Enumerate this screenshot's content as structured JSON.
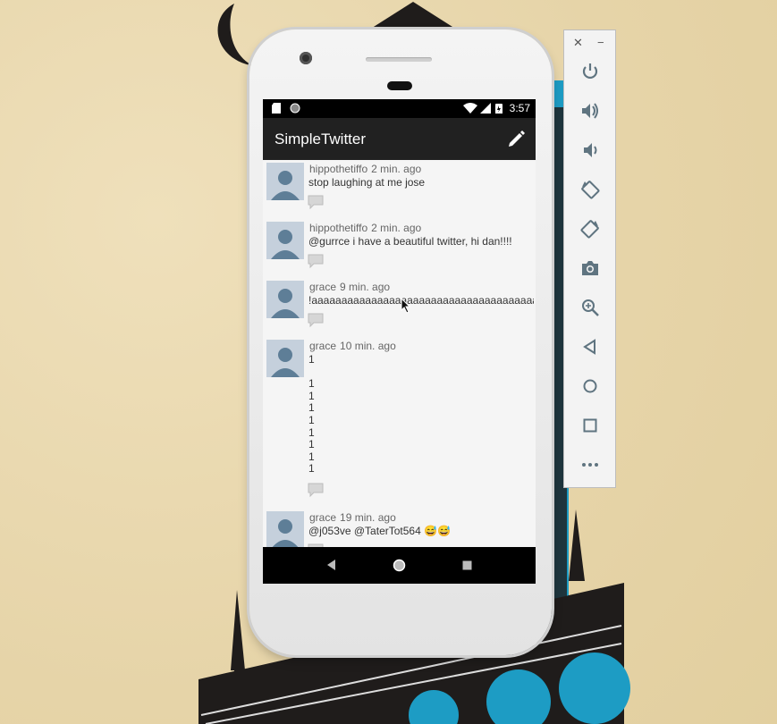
{
  "status_bar": {
    "time": "3:57"
  },
  "app": {
    "title": "SimpleTwitter",
    "compose_icon": "pencil-icon"
  },
  "tweets": [
    {
      "user": "hippothetiffo",
      "time": "2 min. ago",
      "text": "stop laughing at me jose"
    },
    {
      "user": "hippothetiffo",
      "time": "2 min. ago",
      "text": "@gurrce i have a beautiful twitter, hi dan!!!!"
    },
    {
      "user": "grace",
      "time": "9 min. ago",
      "text": "!aaaaaaaaaaaaaaaaaaaaaaaaaaaaaaaaaaaaaaaaa"
    },
    {
      "user": "grace",
      "time": "10 min. ago",
      "text": "1\n\n1\n1\n1\n1\n1\n1\n1\n1"
    },
    {
      "user": "grace",
      "time": "19 min. ago",
      "text": "@j053ve @TaterTot564 😅😅"
    }
  ],
  "emulator_panel": {
    "close_label": "✕",
    "minimize_label": "−",
    "buttons": [
      "power",
      "volume-up",
      "volume-down",
      "rotate-left",
      "rotate-right",
      "screenshot",
      "zoom",
      "back",
      "home",
      "overview",
      "more"
    ]
  },
  "colors": {
    "toolbar": "#212121",
    "accent": "#1da1c8",
    "timeline_bg": "#f5f5f5"
  }
}
